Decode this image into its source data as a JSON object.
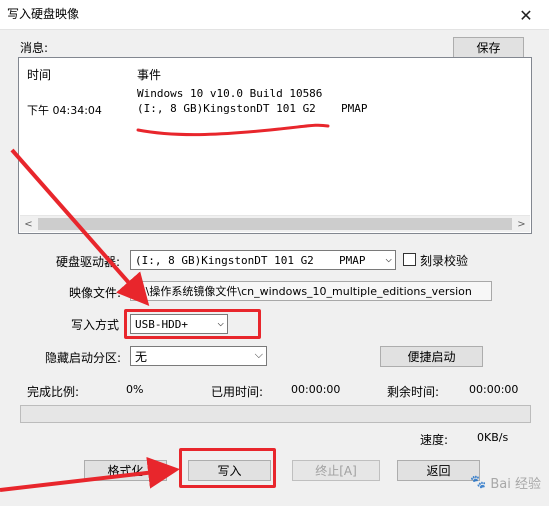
{
  "window": {
    "title": "写入硬盘映像",
    "close_glyph": "✕"
  },
  "messages": {
    "label": "消息:",
    "save_label": "保存",
    "col_time": "时间",
    "col_event": "事件",
    "rows": [
      {
        "time": "",
        "event": "Windows 10 v10.0 Build 10586",
        "extra": ""
      },
      {
        "time": "下午 04:34:04",
        "event": "(I:, 8 GB)KingstonDT 101 G2",
        "extra": "PMAP"
      }
    ]
  },
  "form": {
    "drive_label": "硬盘驱动器:",
    "drive_value": "(I:, 8 GB)KingstonDT 101 G2",
    "drive_extra": "PMAP",
    "verify_label": "刻录校验",
    "image_label": "映像文件:",
    "image_value": "E:\\操作系统镜像文件\\cn_windows_10_multiple_editions_version",
    "write_mode_label": "写入方式",
    "write_mode_value": "USB-HDD+",
    "hidden_label": "隐藏启动分区:",
    "hidden_value": "无",
    "quick_boot_label": "便捷启动"
  },
  "status": {
    "percent_label": "完成比例:",
    "percent_value": "0%",
    "progress": 0,
    "elapsed_label": "已用时间:",
    "elapsed_value": "00:00:00",
    "remaining_label": "剩余时间:",
    "remaining_value": "00:00:00",
    "speed_label": "速度:",
    "speed_value": "0KB/s"
  },
  "actions": {
    "format_label": "格式化",
    "write_label": "写入",
    "stop_label": "终止[A]",
    "back_label": "返回"
  },
  "watermark": "Bai 经验",
  "colors": {
    "annotation_red": "#e8262c",
    "progress_green": "#06b025"
  }
}
